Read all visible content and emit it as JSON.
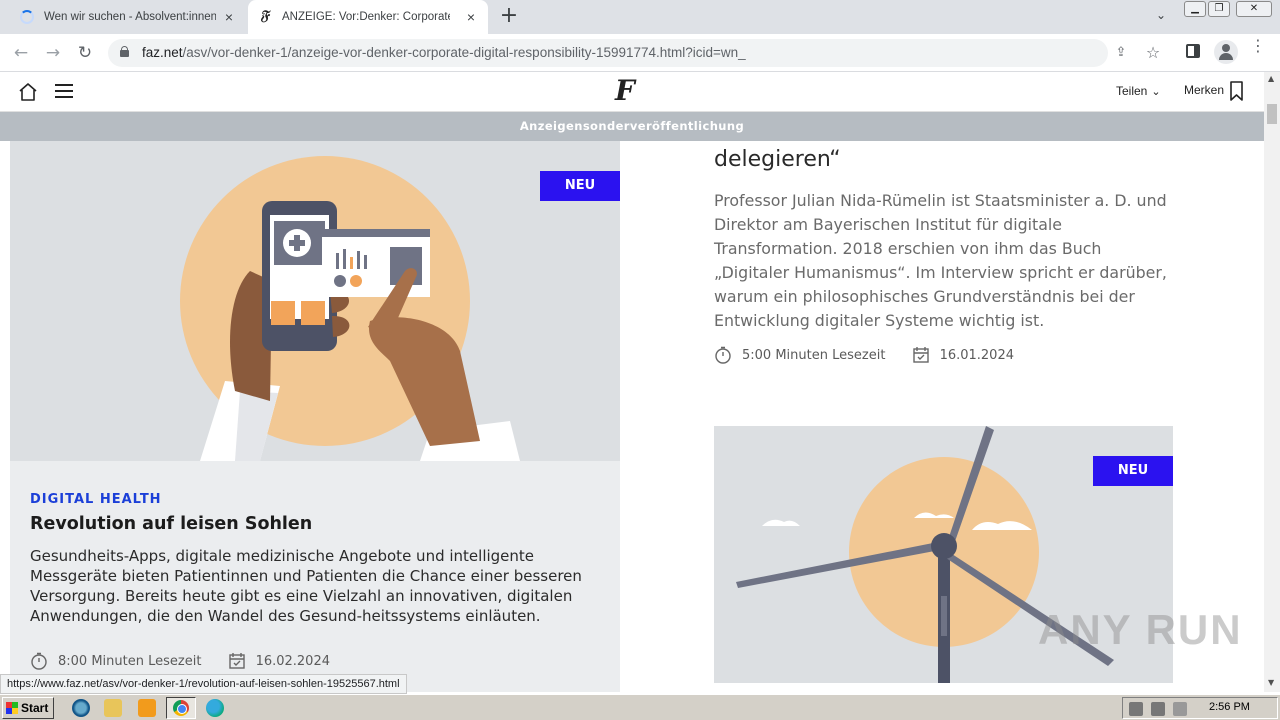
{
  "browser": {
    "tabs": [
      {
        "title": "Wen wir suchen - Absolvent:innen | ..."
      },
      {
        "title": "ANZEIGE: Vor:Denker: Corporate Digital..."
      }
    ],
    "new_tab_label": "+",
    "url_host": "faz.net",
    "url_path": "/asv/vor-denker-1/anzeige-vor-denker-corporate-digital-responsibility-15991774.html?icid=wn_",
    "status_link": "https://www.faz.net/asv/vor-denker-1/revolution-auf-leisen-sohlen-19525567.html"
  },
  "site": {
    "logo": "F",
    "share_label": "Teilen",
    "bookmark_label": "Merken",
    "banner": "Anzeigensonderveröffentlichung"
  },
  "article_left": {
    "badge": "NEU",
    "category": "DIGITAL HEALTH",
    "headline": "Revolution auf leisen Sohlen",
    "teaser": "Gesundheits-Apps, digitale medizinische Angebote und intelligente Messgeräte bieten Patientinnen und Patienten die Chance einer besseren Versorgung. Bereits heute gibt es eine Vielzahl an innovativen, digitalen Anwendungen, die den Wandel des Gesund-heitssystems einläuten.",
    "reading_time": "8:00 Minuten Lesezeit",
    "date": "16.02.2024"
  },
  "article_right": {
    "headline": "delegieren“",
    "teaser": "Professor Julian Nida-Rümelin ist Staatsminister a. D. und Direktor am Bayerischen Institut für digitale Transformation. 2018 erschien von ihm das Buch „Digitaler Humanismus“. Im Interview spricht er darüber, warum ein philosophisches Grundverständnis bei der Entwicklung digitaler Systeme wichtig ist.",
    "reading_time": "5:00 Minuten Lesezeit",
    "date": "16.01.2024"
  },
  "article_right_next": {
    "badge": "NEU"
  },
  "watermark": "ANY RUN",
  "taskbar": {
    "start_label": "Start",
    "clock": "2:56 PM"
  }
}
